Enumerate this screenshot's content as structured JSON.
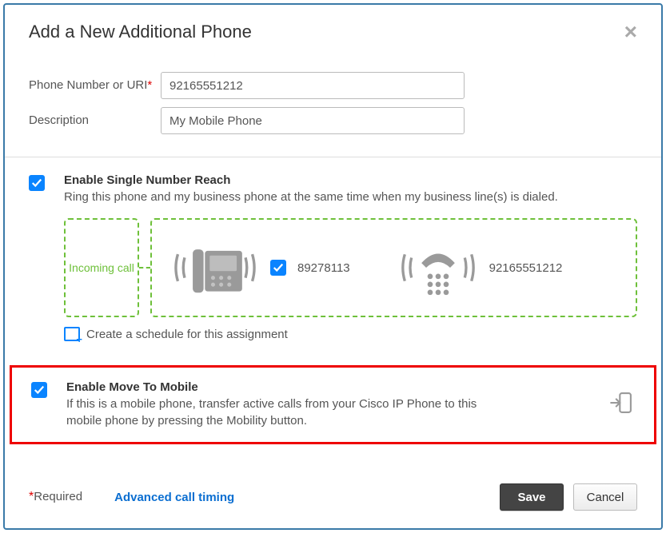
{
  "header": {
    "title": "Add a New Additional Phone"
  },
  "form": {
    "phone_label": "Phone Number or URI",
    "phone_value": "92165551212",
    "desc_label": "Description",
    "desc_value": "My Mobile Phone"
  },
  "snr": {
    "title": "Enable Single Number Reach",
    "desc": "Ring this phone and my business phone at the same time when my business line(s) is dialed.",
    "incoming_label": "Incoming call",
    "desk_number": "89278113",
    "mobile_number": "92165551212",
    "schedule_label": "Create a schedule for this assignment"
  },
  "move": {
    "title": "Enable Move To Mobile",
    "desc": "If this is a mobile phone, transfer active calls from your Cisco IP Phone to this mobile phone by pressing the Mobility button."
  },
  "footer": {
    "required_label": "Required",
    "advanced_label": "Advanced call timing",
    "save_label": "Save",
    "cancel_label": "Cancel"
  }
}
